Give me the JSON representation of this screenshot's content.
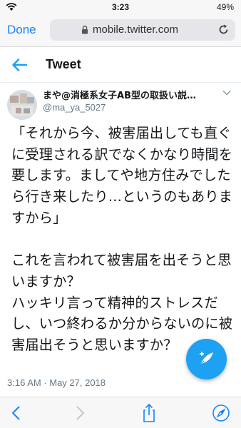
{
  "status_bar": {
    "time": "3:23",
    "battery": "49%"
  },
  "safari": {
    "done_label": "Done",
    "url": "mobile.twitter.com"
  },
  "header": {
    "title": "Tweet"
  },
  "tweet": {
    "author_name": "まや@消極系女子AB型の取扱い説…",
    "handle": "@ma_ya_5027",
    "text": "「それから今、被害届出しても直ぐに受理される訳でなくかなり時間を要します。ましてや地方住みでしたら行き来したり…というのもありますから」\n\nこれを言われて被害届を出そうと思いますか？\nハッキリ言って精神的ストレスだし、いつ終わるか分からないのに被害届出そうと思いますか？",
    "timestamp": "3:16 AM · May 27, 2018"
  },
  "colors": {
    "twitter_blue": "#1da1f2",
    "ios_blue": "#1a82fb"
  },
  "icons": {
    "status_wifi": "wifi-icon",
    "lock": "lock-icon",
    "reload": "reload-icon",
    "back": "back-arrow-icon",
    "caret": "chevron-down-icon",
    "compose": "compose-tweet-icon",
    "toolbar": [
      "back-icon",
      "forward-icon",
      "share-icon",
      "bookmarks-icon",
      "compass-icon"
    ]
  }
}
